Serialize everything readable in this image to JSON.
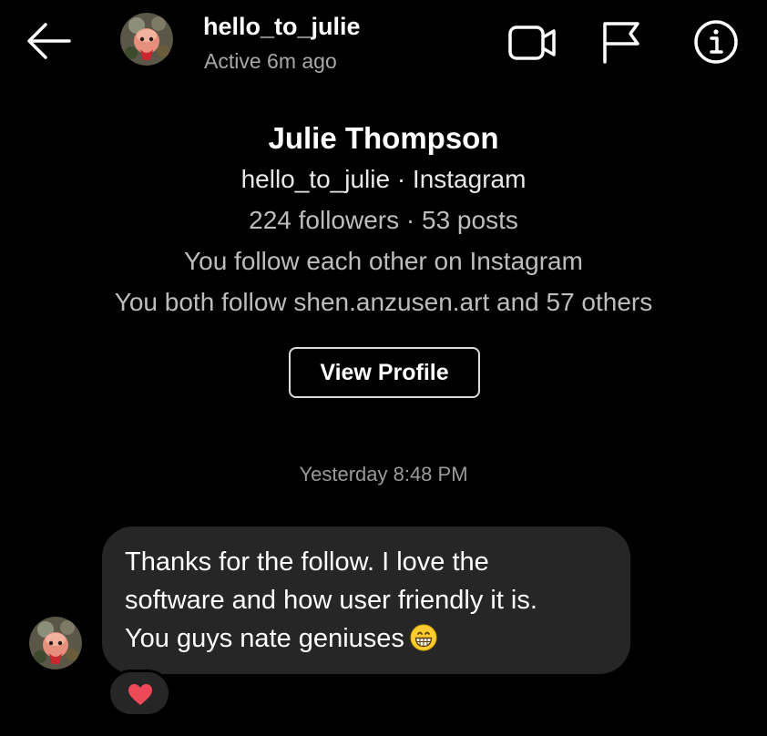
{
  "header": {
    "username": "hello_to_julie",
    "status": "Active 6m ago",
    "icons": {
      "back": "arrow-left-icon",
      "video": "video-call-icon",
      "flag": "flag-icon",
      "info": "info-icon"
    }
  },
  "profile": {
    "name": "Julie Thompson",
    "handle_line": "hello_to_julie · Instagram",
    "stats_line": "224 followers · 53 posts",
    "follow_status": "You follow each other on Instagram",
    "mutual_line": "You both follow shen.anzusen.art and 57 others",
    "view_profile_label": "View Profile"
  },
  "conversation": {
    "timestamp": "Yesterday 8:48 PM",
    "message": {
      "lines": [
        "Thanks for the follow. I love the",
        "software and how user friendly it is.",
        "You guys nate geniuses"
      ],
      "emoji": "grinning-face-emoji",
      "reaction": "heart-reaction"
    }
  },
  "colors": {
    "background": "#000000",
    "bubble": "#262626",
    "secondary_text": "#a8a8a8",
    "heart": "#ed4956"
  }
}
